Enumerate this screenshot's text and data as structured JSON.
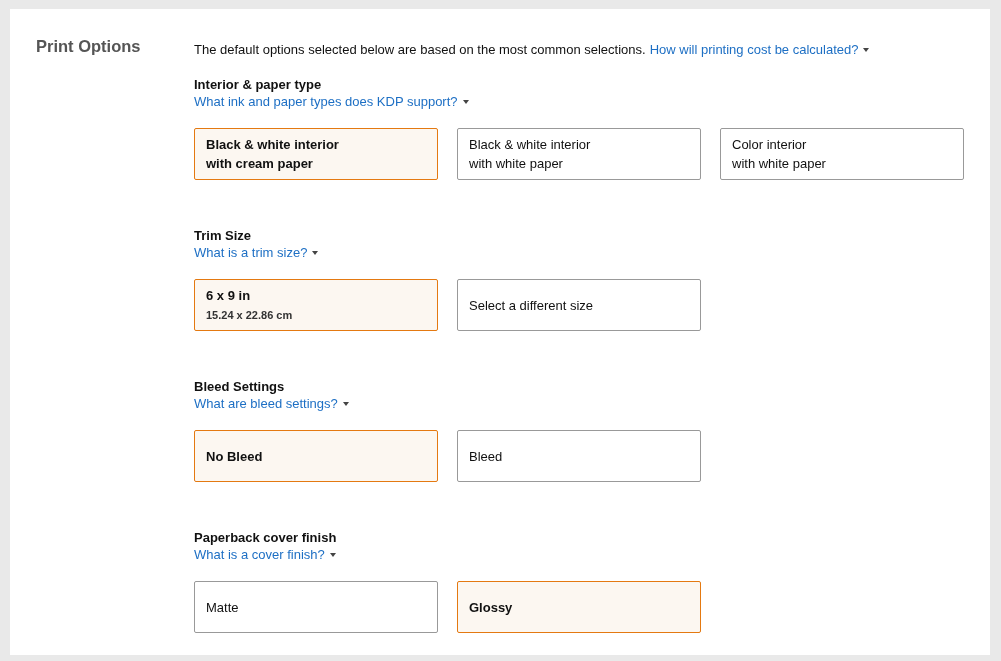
{
  "title": "Print Options",
  "intro": {
    "text": "The default options selected below are based on the most common selections.",
    "link": "How will printing cost be calculated?"
  },
  "sections": [
    {
      "heading": "Interior & paper type",
      "link": "What ink and paper types does KDP support?",
      "options": [
        {
          "lines": [
            "Black & white interior",
            "with cream paper"
          ],
          "selected": true
        },
        {
          "lines": [
            "Black & white interior",
            "with white paper"
          ],
          "selected": false
        },
        {
          "lines": [
            "Color interior",
            "with white paper"
          ],
          "selected": false
        }
      ]
    },
    {
      "heading": "Trim Size",
      "link": "What is a trim size?",
      "options": [
        {
          "lines": [
            "6 x 9 in"
          ],
          "sublabel": "15.24 x 22.86 cm",
          "selected": true
        },
        {
          "lines": [
            "Select a different size"
          ],
          "selected": false
        }
      ]
    },
    {
      "heading": "Bleed Settings",
      "link": "What are bleed settings?",
      "options": [
        {
          "lines": [
            "No Bleed"
          ],
          "selected": true
        },
        {
          "lines": [
            "Bleed"
          ],
          "selected": false
        }
      ]
    },
    {
      "heading": "Paperback cover finish",
      "link": "What is a cover finish?",
      "options": [
        {
          "lines": [
            "Matte"
          ],
          "selected": false
        },
        {
          "lines": [
            "Glossy"
          ],
          "selected": true
        }
      ]
    }
  ]
}
